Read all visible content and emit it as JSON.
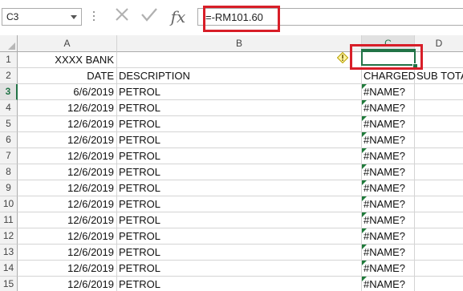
{
  "formula_bar": {
    "name_box": "C3",
    "formula": "=-RM101.60",
    "fx_label": "fx"
  },
  "columns": [
    "A",
    "B",
    "C",
    "D"
  ],
  "selected_cell": "C3",
  "rows": [
    {
      "num": "1",
      "a": "XXXX BANK",
      "b": "",
      "c": "",
      "d": ""
    },
    {
      "num": "2",
      "a": "DATE",
      "b": "DESCRIPTION",
      "c": "CHARGED",
      "d": "SUB TOTAL"
    },
    {
      "num": "3",
      "a": "6/6/2019",
      "b": "PETROL",
      "c": "#NAME?",
      "d": ""
    },
    {
      "num": "4",
      "a": "12/6/2019",
      "b": "PETROL",
      "c": "#NAME?",
      "d": ""
    },
    {
      "num": "5",
      "a": "12/6/2019",
      "b": "PETROL",
      "c": "#NAME?",
      "d": ""
    },
    {
      "num": "6",
      "a": "12/6/2019",
      "b": "PETROL",
      "c": "#NAME?",
      "d": ""
    },
    {
      "num": "7",
      "a": "12/6/2019",
      "b": "PETROL",
      "c": "#NAME?",
      "d": ""
    },
    {
      "num": "8",
      "a": "12/6/2019",
      "b": "PETROL",
      "c": "#NAME?",
      "d": ""
    },
    {
      "num": "9",
      "a": "12/6/2019",
      "b": "PETROL",
      "c": "#NAME?",
      "d": ""
    },
    {
      "num": "10",
      "a": "12/6/2019",
      "b": "PETROL",
      "c": "#NAME?",
      "d": ""
    },
    {
      "num": "11",
      "a": "12/6/2019",
      "b": "PETROL",
      "c": "#NAME?",
      "d": ""
    },
    {
      "num": "12",
      "a": "12/6/2019",
      "b": "PETROL",
      "c": "#NAME?",
      "d": ""
    },
    {
      "num": "13",
      "a": "12/6/2019",
      "b": "PETROL",
      "c": "#NAME?",
      "d": ""
    },
    {
      "num": "14",
      "a": "12/6/2019",
      "b": "PETROL",
      "c": "#NAME?",
      "d": ""
    },
    {
      "num": "15",
      "a": "12/6/2019",
      "b": "PETROL",
      "c": "#NAME?",
      "d": ""
    }
  ],
  "colors": {
    "accent_green": "#217346",
    "highlight_red": "#d81e28",
    "error_triangle": "#1f7a3a"
  }
}
